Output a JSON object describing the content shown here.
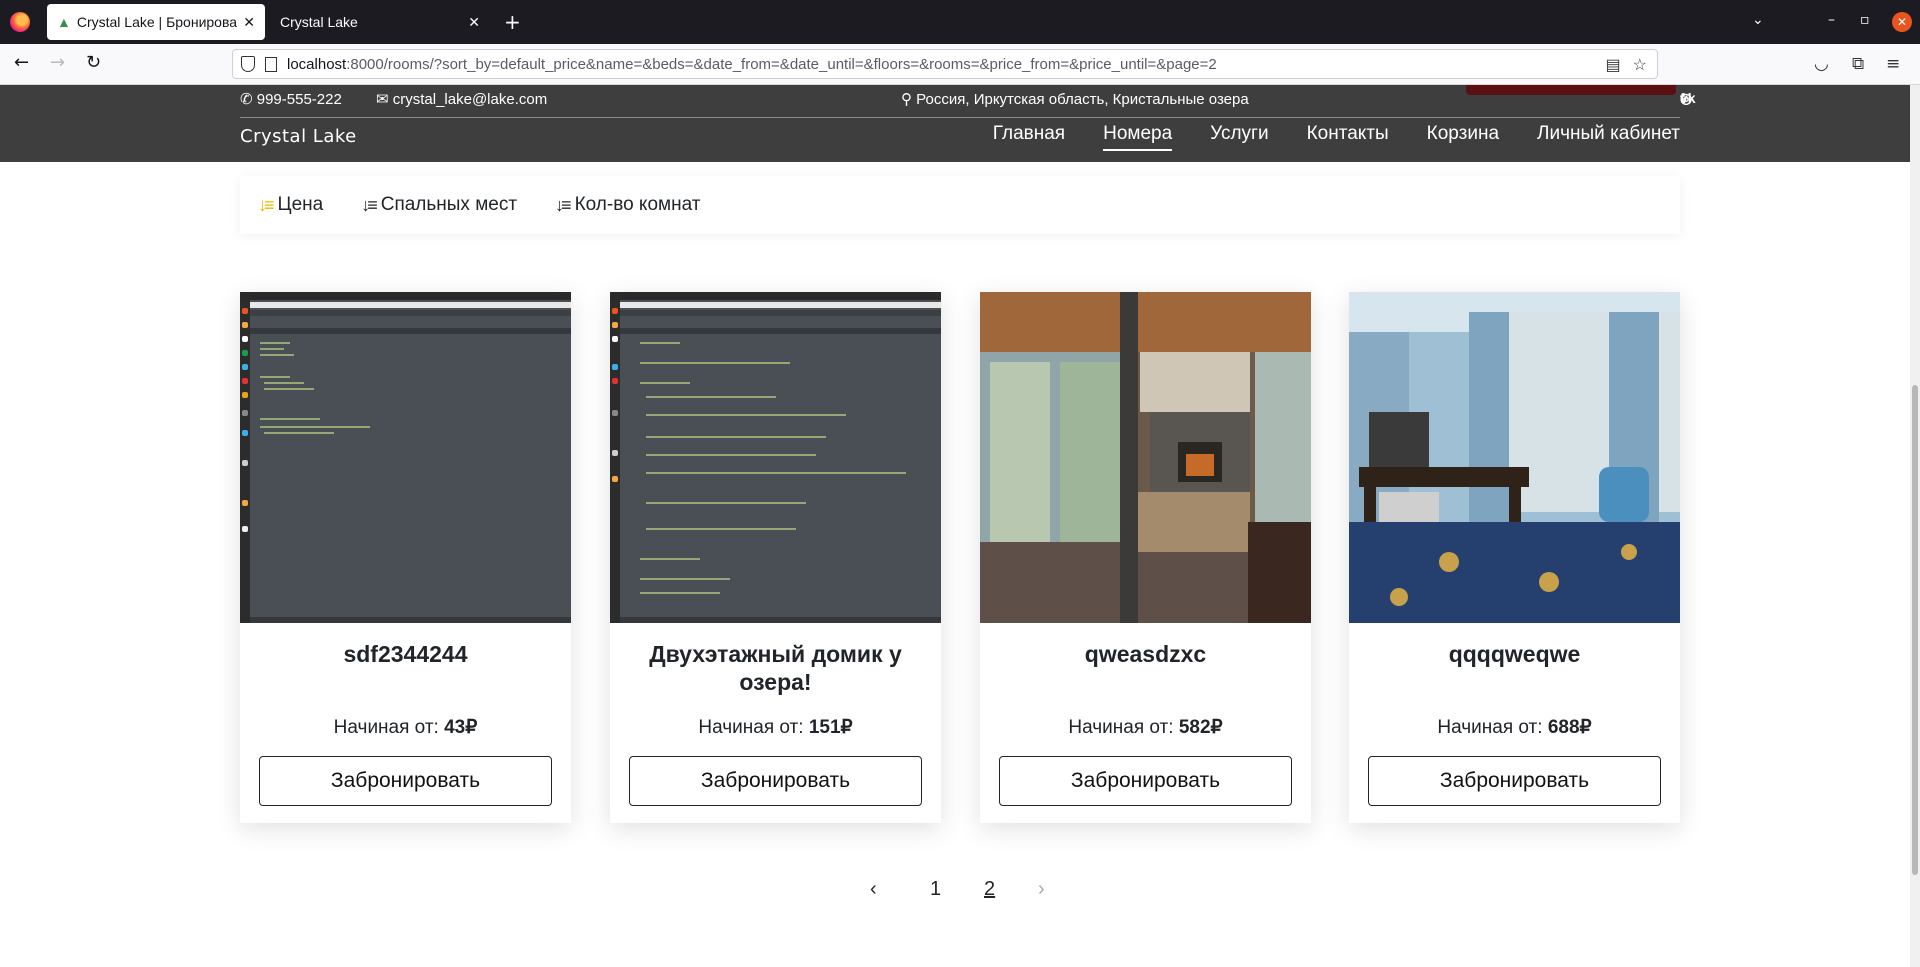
{
  "browser": {
    "tabs": [
      {
        "title": "Crystal Lake | Бронирова",
        "active": true
      },
      {
        "title": "Crystal Lake",
        "active": false
      }
    ],
    "url": {
      "host": "localhost",
      "rest": ":8000/rooms/?sort_by=default_price&name=&beds=&date_from=&date_until=&floors=&rooms=&price_from=&price_until=&page=2"
    }
  },
  "header": {
    "phone": "999-555-222",
    "email": "crystal_lake@lake.com",
    "address": "Россия, Иркутская область, Кристальные озера",
    "logo": "Crystal Lake",
    "nav": [
      "Главная",
      "Номера",
      "Услуги",
      "Контакты",
      "Корзина",
      "Личный кабинет"
    ],
    "nav_current": "Номера",
    "social_icons": [
      "instagram-icon",
      "vk-icon",
      "facebook-icon"
    ]
  },
  "sort": {
    "items": [
      "Цена",
      "Спальных мест",
      "Кол-во комнат"
    ],
    "active": "Цена",
    "accent": "#f0b400"
  },
  "rooms": [
    {
      "name": "sdf2344244",
      "price_label": "Начиная от:",
      "price": "43₽",
      "button": "Забронировать",
      "image": "code-screenshot"
    },
    {
      "name": "Двухэтажный домик у озера!",
      "price_label": "Начиная от:",
      "price": "151₽",
      "button": "Забронировать",
      "image": "code-screenshot"
    },
    {
      "name": "qweasdzxc",
      "price_label": "Начиная от:",
      "price": "582₽",
      "button": "Забронировать",
      "image": "interior-lobby"
    },
    {
      "name": "qqqqweqwe",
      "price_label": "Начиная от:",
      "price": "688₽",
      "button": "Забронировать",
      "image": "hotel-room"
    }
  ],
  "pagination": {
    "prev": "‹",
    "pages": [
      "1",
      "2"
    ],
    "current": "2",
    "next": "›"
  }
}
